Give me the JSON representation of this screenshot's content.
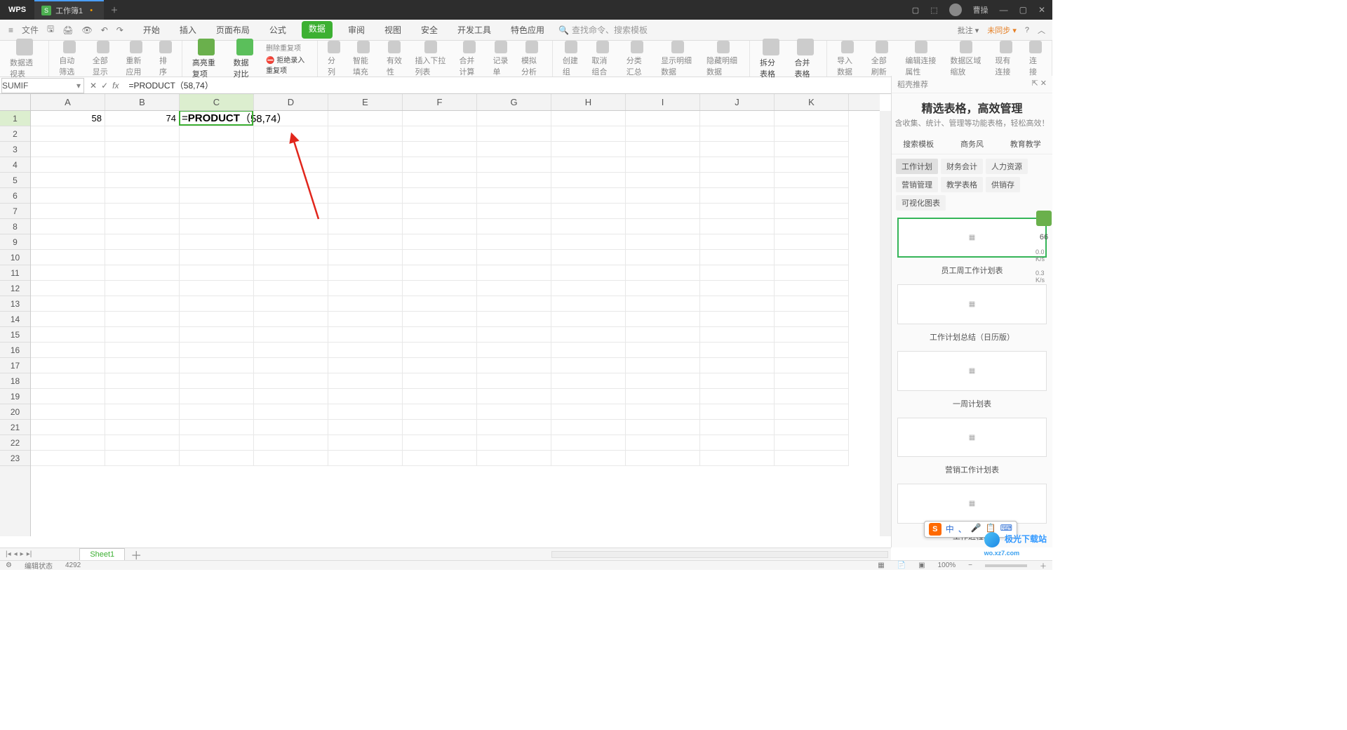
{
  "title_bar": {
    "app": "WPS",
    "doc": "工作簿1",
    "dirty": "•",
    "user": "曹操"
  },
  "menu": {
    "file": "文件",
    "tabs": [
      "开始",
      "插入",
      "页面布局",
      "公式",
      "数据",
      "审阅",
      "视图",
      "安全",
      "开发工具",
      "特色应用"
    ],
    "active": 4,
    "search_placeholder": "查找命令、搜索模板",
    "right": {
      "approve": "批注 ▾",
      "unsync": "未同步 ▾"
    }
  },
  "ribbon": {
    "g1": [
      "数据透视表"
    ],
    "g2": [
      "自动筛选",
      "全部显示",
      "重新应用",
      "排序"
    ],
    "g3": [
      "高亮重复项",
      "数据对比",
      "删除重复项",
      "拒绝录入重复项"
    ],
    "g4": [
      "分列",
      "智能填充",
      "有效性",
      "插入下拉列表",
      "合并计算",
      "记录单",
      "模拟分析"
    ],
    "g5": [
      "创建组",
      "取消组合",
      "分类汇总",
      "显示明细数据",
      "隐藏明细数据"
    ],
    "g6": [
      "拆分表格",
      "合并表格"
    ],
    "g7": [
      "导入数据",
      "全部刷新",
      "编辑连接属性",
      "数据区域缩放",
      "现有连接",
      "连接"
    ]
  },
  "formula_bar": {
    "name_box": "SUMIF",
    "formula": "=PRODUCT（58,74）"
  },
  "grid": {
    "columns": [
      "A",
      "B",
      "C",
      "D",
      "E",
      "F",
      "G",
      "H",
      "I",
      "J",
      "K"
    ],
    "active_col": 2,
    "row_count": 23,
    "active_row": 0,
    "cells": {
      "A1": "58",
      "B1": "74"
    },
    "formula_cell": {
      "prefix": "=",
      "fn": "PRODUCT",
      "args": "（58,74）"
    }
  },
  "sheets": {
    "active": "Sheet1"
  },
  "right_panel": {
    "title": "稻壳推荐",
    "headline": "精选表格，高效管理",
    "subtitle": "含收集、统计、管理等功能表格，轻松高效！",
    "tab_search": "搜索模板",
    "tabs": [
      "商务风",
      "教育教学"
    ],
    "cats": [
      "工作计划",
      "财务会计",
      "人力资源",
      "营销管理",
      "教学表格",
      "供销存",
      "可视化图表"
    ],
    "tpl_labels": [
      "员工周工作计划表",
      "工作计划总结（日历版）",
      "一周计划表",
      "营销工作计划表",
      "工作进程表"
    ]
  },
  "side_strip": {
    "score": "66",
    "v1": "0.0 K/s",
    "v2": "0.3 K/s"
  },
  "status": {
    "mode": "编辑状态",
    "chars": "4292",
    "zoom": "100%"
  },
  "ime": [
    "中",
    "、",
    "🎤",
    "📋",
    "⌨"
  ],
  "watermark": {
    "brand": "极光下载站",
    "url": "wo.xz7.com"
  }
}
